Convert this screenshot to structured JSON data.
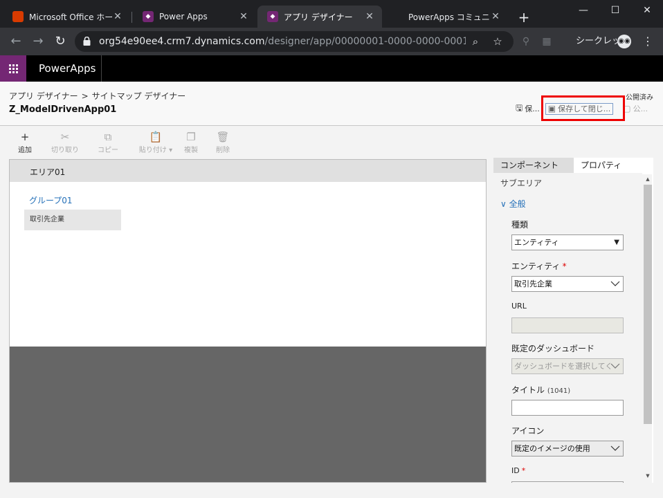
{
  "browser": {
    "tabs": [
      {
        "title": "Microsoft Office ホーム",
        "favicon": "office-icon"
      },
      {
        "title": "Power Apps",
        "favicon": "powerapps-icon"
      },
      {
        "title": "アプリ デザイナー",
        "favicon": "powerapps-icon",
        "active": true
      },
      {
        "title": "PowerApps コミュニティ",
        "favicon": "microsoft-icon"
      }
    ],
    "new_tab": "+",
    "window_controls": {
      "minimize": "—",
      "maximize": "☐",
      "close": "✕"
    },
    "url_host": "org54e90ee4.crm7.dynamics.com",
    "url_path": "/designer/app/00000001-0000-0000-0001-00000...",
    "incognito_label": "シークレット"
  },
  "header": {
    "brand": "PowerApps"
  },
  "titlebar": {
    "breadcrumb_root": "アプリ デザイナー",
    "breadcrumb_separator": ">",
    "breadcrumb_current": "サイトマップ デザイナー",
    "app_name": "Z_ModelDrivenApp01",
    "status": "公開済み",
    "save_label": "保...",
    "save_close_label": "保存して閉じ...",
    "publish_label": "公..."
  },
  "commands": {
    "add": "追加",
    "cut": "切り取り",
    "copy": "コピー",
    "paste": "貼り付け",
    "clone": "複製",
    "delete": "削除"
  },
  "canvas": {
    "area_tab": "エリア01",
    "group": "グループ01",
    "subarea": "取引先企業"
  },
  "panel": {
    "tab_components": "コンポーネント",
    "tab_properties": "プロパティ",
    "section": "サブエリア",
    "general": "全般",
    "type_label": "種類",
    "type_value": "エンティティ",
    "entity_label": "エンティティ",
    "entity_required": "*",
    "entity_value": "取引先企業",
    "url_label": "URL",
    "url_value": "",
    "dashboard_label": "既定のダッシュボード",
    "dashboard_value": "ダッシュボードを選択してく",
    "title_label": "タイトル",
    "title_count": "(1041)",
    "title_value": "",
    "icon_label": "アイコン",
    "icon_value": "既定のイメージの使用",
    "id_label": "ID",
    "id_required": "*"
  },
  "colors": {
    "accent": "#742774",
    "link": "#2470b8",
    "highlight": "#ee0000",
    "chrome_dark": "#202124"
  }
}
